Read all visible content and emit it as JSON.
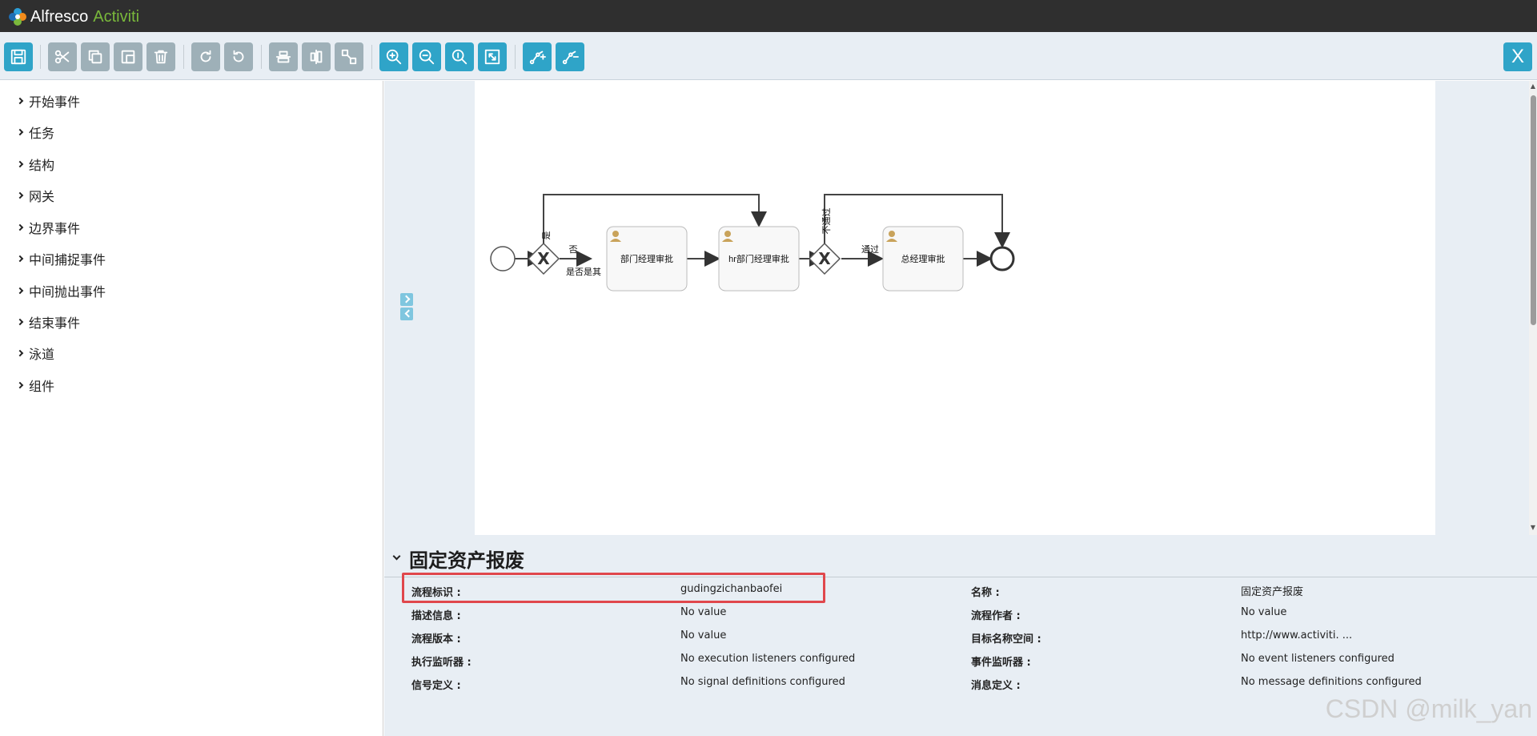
{
  "app": {
    "logo_word1": "Alfresco",
    "logo_word2": "Activiti",
    "logo_icon": "alfresco-flower-icon"
  },
  "toolbar": {
    "buttons": [
      {
        "name": "save",
        "icon": "floppy-icon"
      },
      {
        "name": "cut",
        "icon": "scissors-icon"
      },
      {
        "name": "copy",
        "icon": "copy-icon"
      },
      {
        "name": "paste",
        "icon": "paste-icon"
      },
      {
        "name": "delete",
        "icon": "trash-icon"
      },
      {
        "name": "redo",
        "icon": "redo-icon"
      },
      {
        "name": "undo",
        "icon": "undo-icon"
      },
      {
        "name": "align-horizontal",
        "icon": "align-horizontal-icon"
      },
      {
        "name": "align-vertical",
        "icon": "align-vertical-icon"
      },
      {
        "name": "same-size",
        "icon": "same-size-icon"
      },
      {
        "name": "zoom-in",
        "icon": "zoom-in-icon"
      },
      {
        "name": "zoom-out",
        "icon": "zoom-out-icon"
      },
      {
        "name": "zoom-actual",
        "icon": "zoom-actual-icon"
      },
      {
        "name": "zoom-fit",
        "icon": "zoom-fit-icon"
      },
      {
        "name": "add-bendpoint",
        "icon": "add-bendpoint-icon"
      },
      {
        "name": "remove-bendpoint",
        "icon": "remove-bendpoint-icon"
      }
    ],
    "close_label": "X"
  },
  "palette": {
    "items": [
      {
        "label": "开始事件"
      },
      {
        "label": "任务"
      },
      {
        "label": "结构"
      },
      {
        "label": "网关"
      },
      {
        "label": "边界事件"
      },
      {
        "label": "中间捕捉事件"
      },
      {
        "label": "中间抛出事件"
      },
      {
        "label": "结束事件"
      },
      {
        "label": "泳道"
      },
      {
        "label": "组件"
      }
    ]
  },
  "diagram": {
    "tasks": [
      {
        "label": "部门经理审批"
      },
      {
        "label": "hr部门经理审批"
      },
      {
        "label": "总经理审批"
      }
    ],
    "flows": {
      "yes": "是",
      "no": "否",
      "condition": "是否是其",
      "reject": "不通过",
      "pass": "通过"
    }
  },
  "properties": {
    "title": "固定资产报废",
    "rows": [
      {
        "label": "流程标识 :",
        "value": "gudingzichanbaofei",
        "label2": "名称 :",
        "value2": "固定资产报废"
      },
      {
        "label": "描述信息 :",
        "value": "No value",
        "label2": "流程作者 :",
        "value2": "No value"
      },
      {
        "label": "流程版本 :",
        "value": "No value",
        "label2": "目标名称空间 :",
        "value2": "http://www.activiti. ..."
      },
      {
        "label": "执行监听器 :",
        "value": "No execution listeners configured",
        "label2": "事件监听器 :",
        "value2": "No event listeners configured"
      },
      {
        "label": "信号定义 :",
        "value": "No signal definitions configured",
        "label2": "消息定义 :",
        "value2": "No message definitions configured"
      }
    ]
  },
  "watermark": "CSDN @milk_yan",
  "colors": {
    "toolbar_blue": "#2fa4c8",
    "toolbar_gray": "#9eb0b8",
    "highlight": "#e0474c",
    "topbar": "#2f2f2f"
  }
}
